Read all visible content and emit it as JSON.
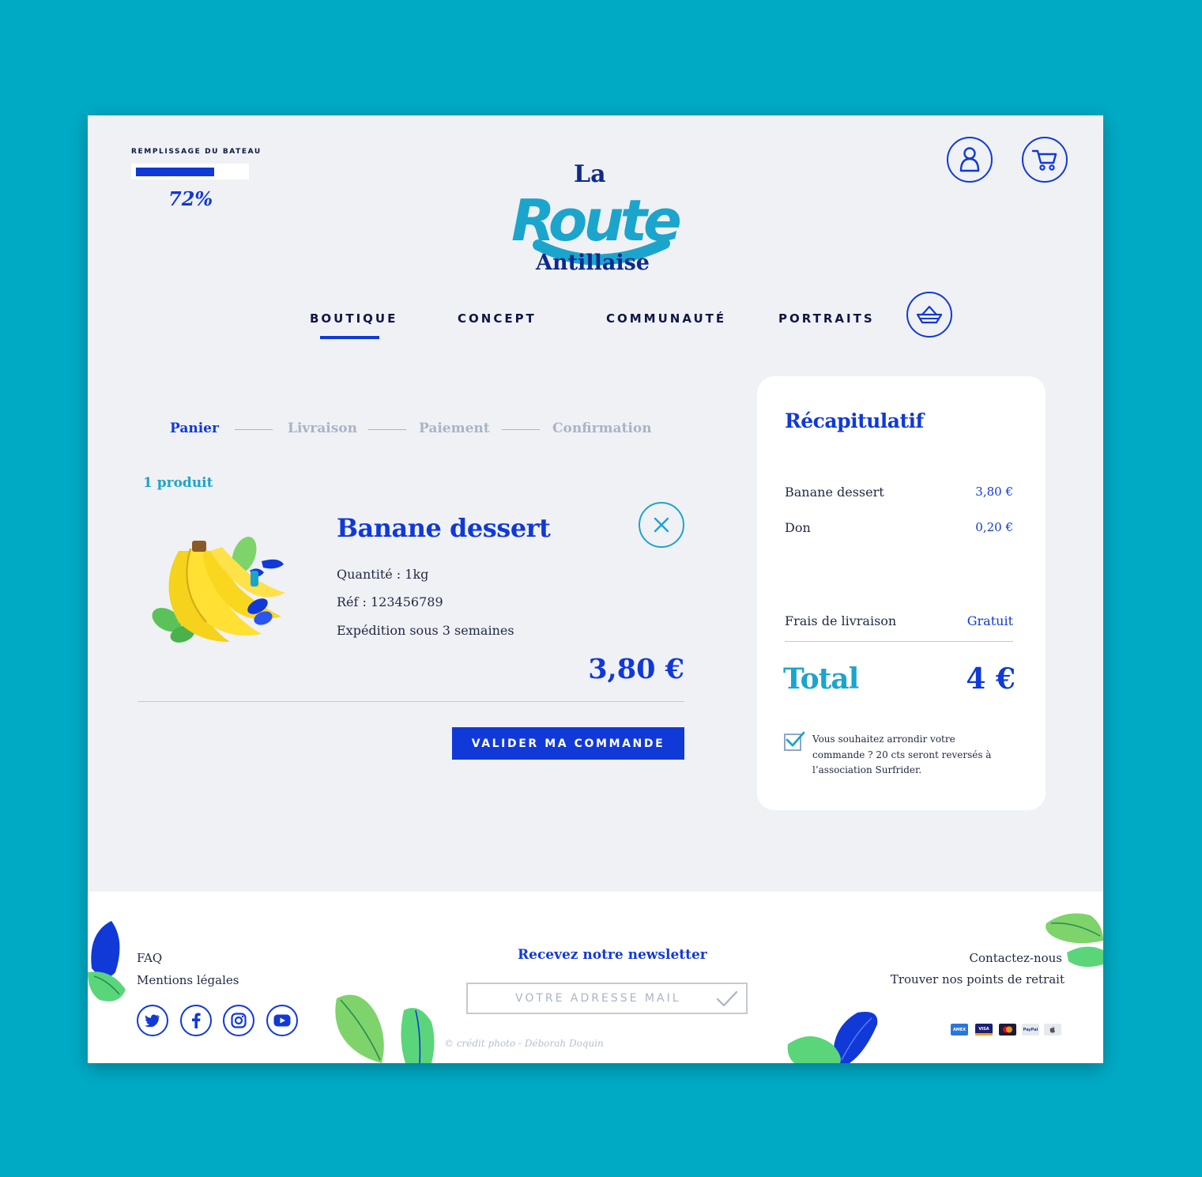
{
  "header": {
    "fill_label": "REMPLISSAGE DU BATEAU",
    "fill_percent": 72,
    "fill_percent_text": "72%",
    "logo_line1": "La",
    "logo_line2": "Route",
    "logo_line3": "Antillaise"
  },
  "nav": {
    "items": [
      {
        "label": "BOUTIQUE",
        "active": true
      },
      {
        "label": "CONCEPT",
        "active": false
      },
      {
        "label": "COMMUNAUTÉ",
        "active": false
      },
      {
        "label": "PORTRAITS",
        "active": false
      }
    ]
  },
  "steps": [
    {
      "label": "Panier",
      "active": true
    },
    {
      "label": "Livraison",
      "active": false
    },
    {
      "label": "Paiement",
      "active": false
    },
    {
      "label": "Confirmation",
      "active": false
    }
  ],
  "cart": {
    "count_text": "1 produit",
    "product": {
      "title": "Banane dessert",
      "quantity": "Quantité : 1kg",
      "ref": "Réf : 123456789",
      "shipping": "Expédition sous 3 semaines",
      "price": "3,80 €"
    },
    "validate_label": "VALIDER MA COMMANDE"
  },
  "summary": {
    "title": "Récapitulatif",
    "rows": [
      {
        "label": "Banane dessert",
        "value": "3,80 €"
      },
      {
        "label": "Don",
        "value": "0,20 €"
      }
    ],
    "shipping_label": "Frais de livraison",
    "shipping_value": "Gratuit",
    "total_label": "Total",
    "total_value": "4 €",
    "round_up_checked": true,
    "round_up_text": "Vous souhaitez arrondir votre commande ? 20 cts seront reversés à l’association Surfrider."
  },
  "footer": {
    "left_links": [
      "FAQ",
      "Mentions légales"
    ],
    "newsletter_title": "Recevez notre newsletter",
    "newsletter_placeholder": "VOTRE ADRESSE MAIL",
    "credit": "© crédit photo - Déborah Doquin",
    "right_links": [
      "Contactez-nous",
      "Trouver nos points de retrait"
    ],
    "social_icons": [
      "twitter-icon",
      "facebook-icon",
      "instagram-icon",
      "youtube-icon"
    ],
    "payment_icons": [
      "amex-icon",
      "visa-icon",
      "mastercard-icon",
      "paypal-icon",
      "apple-pay-icon"
    ]
  },
  "colors": {
    "brand_blue": "#1039d8",
    "brand_teal": "#1ba5cc",
    "page_background": "#00aac5",
    "panel_background": "#f0f1f5"
  }
}
